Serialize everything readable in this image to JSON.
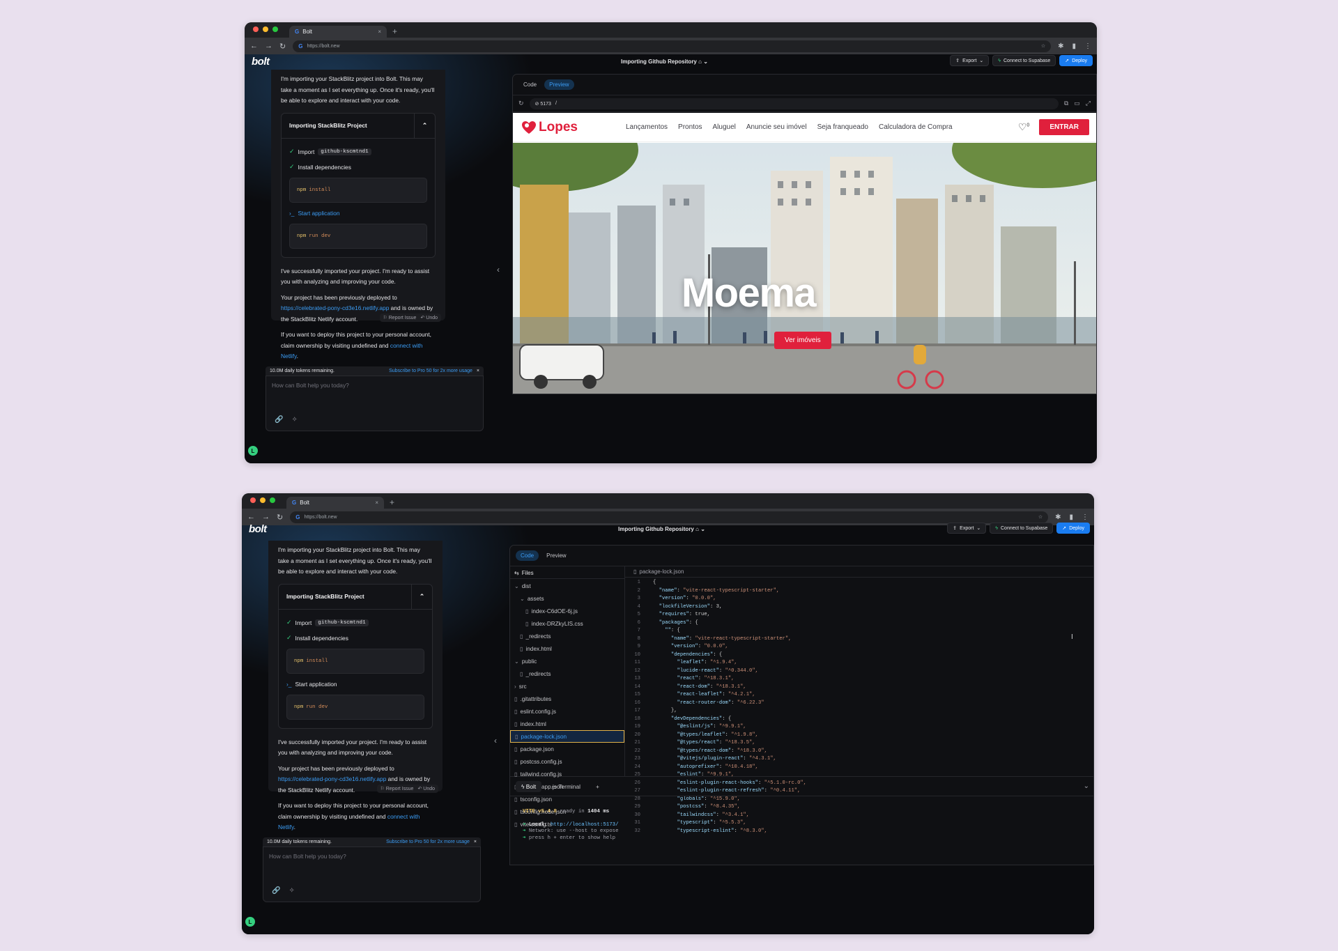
{
  "browser": {
    "tab_title": "Bolt",
    "close_glyph": "×",
    "new_tab_glyph": "+",
    "url": "https://bolt.new",
    "favicon_letter": "G"
  },
  "app": {
    "logo": "bolt",
    "title": "Importing Github Repository",
    "export_label": "Export",
    "connect_label": "Connect to Supabase",
    "deploy_label": "Deploy"
  },
  "chat": {
    "intro": "I'm importing your StackBlitz project into Bolt. This may take a moment as I set everything up. Once it's ready, you'll be able to explore and interact with your code.",
    "card_title": "Importing StackBlitz Project",
    "step_import_label": "Import",
    "step_import_repo": "github-kscmtnd1",
    "step_install": "Install dependencies",
    "cmd_install_bin": "npm",
    "cmd_install_args": "install",
    "step_start": "Start application",
    "cmd_dev_bin": "npm",
    "cmd_dev_args": "run dev",
    "success": "I've successfully imported your project. I'm ready to assist you with analyzing and improving your code.",
    "deployed_pre": "Your project has been previously deployed to ",
    "deployed_link": "https://celebrated-pony-cd3e16.netlify.app",
    "deployed_post": " and is owned by the StackBlitz Netlify account.",
    "deploy_pre": "If you want to deploy this project to your personal account, claim ownership by visiting undefined and ",
    "deploy_link": "connect with Netlify",
    "deploy_post": ".",
    "report_issue": "Report Issue",
    "undo": "Undo",
    "tokens": "10.0M daily tokens remaining.",
    "subscribe": "Subscribe to Pro 50 for 2x more usage",
    "input_placeholder": "How can Bolt help you today?",
    "avatar_letter": "L"
  },
  "workbench": {
    "tab_code": "Code",
    "tab_preview": "Preview",
    "port": "5173",
    "path": "/"
  },
  "site": {
    "logo": "Lopes",
    "nav": [
      "Lançamentos",
      "Prontos",
      "Aluguel",
      "Anuncie seu imóvel",
      "Seja franqueado",
      "Calculadora de Compra"
    ],
    "fav_count": "0",
    "login": "ENTRAR",
    "hero_title": "Moema",
    "hero_button": "Ver imóveis"
  },
  "ide": {
    "files_label": "Files",
    "tree": [
      {
        "name": "dist",
        "kind": "folder",
        "depth": 0
      },
      {
        "name": "assets",
        "kind": "folder",
        "depth": 1
      },
      {
        "name": "index-C6dOE-6j.js",
        "kind": "file",
        "depth": 2
      },
      {
        "name": "index-DRZkyLIS.css",
        "kind": "file",
        "depth": 2
      },
      {
        "name": "_redirects",
        "kind": "file",
        "depth": 1
      },
      {
        "name": "index.html",
        "kind": "file",
        "depth": 1
      },
      {
        "name": "public",
        "kind": "folder",
        "depth": 0
      },
      {
        "name": "_redirects",
        "kind": "file",
        "depth": 1
      },
      {
        "name": "src",
        "kind": "folder-closed",
        "depth": 0
      },
      {
        "name": ".gitattributes",
        "kind": "file",
        "depth": 0
      },
      {
        "name": "eslint.config.js",
        "kind": "file",
        "depth": 0
      },
      {
        "name": "index.html",
        "kind": "file",
        "depth": 0
      },
      {
        "name": "package-lock.json",
        "kind": "file",
        "depth": 0,
        "selected": true
      },
      {
        "name": "package.json",
        "kind": "file",
        "depth": 0
      },
      {
        "name": "postcss.config.js",
        "kind": "file",
        "depth": 0
      },
      {
        "name": "tailwind.config.js",
        "kind": "file",
        "depth": 0
      },
      {
        "name": "tsconfig.app.json",
        "kind": "file",
        "depth": 0
      },
      {
        "name": "tsconfig.json",
        "kind": "file",
        "depth": 0
      },
      {
        "name": "tsconfig.node.json",
        "kind": "file",
        "depth": 0
      },
      {
        "name": "vite.config.ts",
        "kind": "file",
        "depth": 0
      }
    ],
    "open_file": "package-lock.json",
    "code": [
      "{",
      "  \"name\": \"vite-react-typescript-starter\",",
      "  \"version\": \"0.0.0\",",
      "  \"lockfileVersion\": 3,",
      "  \"requires\": true,",
      "  \"packages\": {",
      "    \"\": {",
      "      \"name\": \"vite-react-typescript-starter\",",
      "      \"version\": \"0.0.0\",",
      "      \"dependencies\": {",
      "        \"leaflet\": \"^1.9.4\",",
      "        \"lucide-react\": \"^0.344.0\",",
      "        \"react\": \"^18.3.1\",",
      "        \"react-dom\": \"^18.3.1\",",
      "        \"react-leaflet\": \"^4.2.1\",",
      "        \"react-router-dom\": \"^6.22.3\"",
      "      },",
      "      \"devDependencies\": {",
      "        \"@eslint/js\": \"^9.9.1\",",
      "        \"@types/leaflet\": \"^1.9.8\",",
      "        \"@types/react\": \"^18.3.5\",",
      "        \"@types/react-dom\": \"^18.3.0\",",
      "        \"@vitejs/plugin-react\": \"^4.3.1\",",
      "        \"autoprefixer\": \"^10.4.18\",",
      "        \"eslint\": \"^9.9.1\",",
      "        \"eslint-plugin-react-hooks\": \"^5.1.0-rc.0\",",
      "        \"eslint-plugin-react-refresh\": \"^0.4.11\",",
      "        \"globals\": \"^15.9.0\",",
      "        \"postcss\": \"^8.4.35\",",
      "        \"tailwindcss\": \"^3.4.1\",",
      "        \"typescript\": \"^5.5.3\",",
      "        \"typescript-eslint\": \"^8.3.0\","
    ],
    "term_tab_bolt": "Bolt",
    "term_tab_terminal": "Terminal",
    "term_vite": "VITE v5.4.8",
    "term_ready_pre": "ready in ",
    "term_ready_ms": "1404 ms",
    "term_local_label": "Local:",
    "term_local_url": "http://localhost:5173/",
    "term_network": "Network: use --host to expose",
    "term_help": "press h + enter to show help"
  },
  "colors": {
    "accent": "#1a7cf0",
    "brand_red": "#e0203c",
    "success": "#35d07f",
    "link": "#3b9cf4"
  }
}
